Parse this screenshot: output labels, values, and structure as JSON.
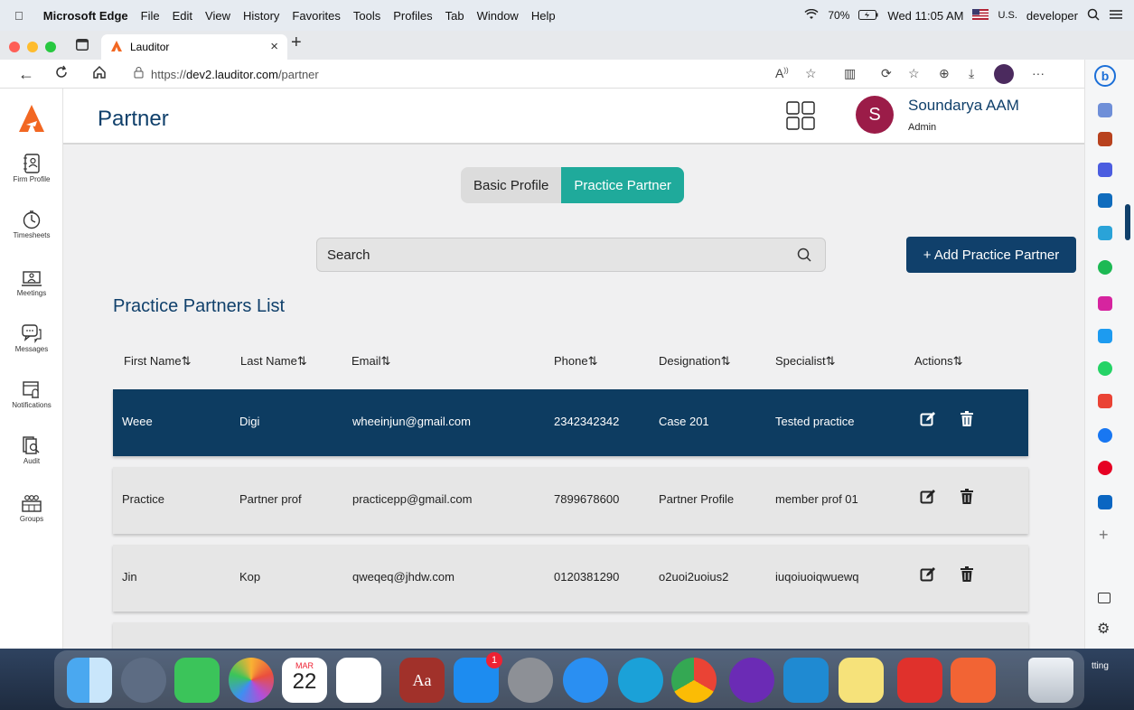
{
  "menubar": {
    "app_name": "Microsoft Edge",
    "menus": [
      "File",
      "Edit",
      "View",
      "History",
      "Favorites",
      "Tools",
      "Profiles",
      "Tab",
      "Window",
      "Help"
    ],
    "battery": "70%",
    "clock": "Wed 11:05 AM",
    "input_source": "U.S.",
    "user": "developer"
  },
  "browser": {
    "tab_title": "Lauditor",
    "url_prefix": "https://",
    "url_host": "dev2.lauditor.com",
    "url_path": "/partner"
  },
  "sidebar": {
    "items": [
      {
        "label": "Firm Profile",
        "icon": "contact-book-icon"
      },
      {
        "label": "Timesheets",
        "icon": "stopwatch-icon"
      },
      {
        "label": "Meetings",
        "icon": "meeting-icon"
      },
      {
        "label": "Messages",
        "icon": "chat-icon"
      },
      {
        "label": "Notifications",
        "icon": "calendar-bell-icon"
      },
      {
        "label": "Audit",
        "icon": "audit-icon"
      },
      {
        "label": "Groups",
        "icon": "groups-icon"
      }
    ]
  },
  "header": {
    "title": "Partner",
    "avatar_letter": "S",
    "user_name": "Soundarya AAM",
    "user_role": "Admin"
  },
  "toggle": {
    "basic": "Basic Profile",
    "practice": "Practice Partner"
  },
  "search": {
    "placeholder": "Search"
  },
  "add_button": "+ Add Practice Partner",
  "list_title": "Practice Partners List",
  "table": {
    "headers": [
      "First Name",
      "Last Name",
      "Email",
      "Phone",
      "Designation",
      "Specialist",
      "Actions"
    ],
    "rows": [
      {
        "first": "Weee",
        "last": "Digi",
        "email": "wheeinjun@gmail.com",
        "phone": "2342342342",
        "designation": "Case 201",
        "specialist": "Tested practice"
      },
      {
        "first": "Practice",
        "last": "Partner prof",
        "email": "practicepp@gmail.com",
        "phone": "7899678600",
        "designation": "Partner Profile",
        "specialist": "member prof 01"
      },
      {
        "first": "Jin",
        "last": "Kop",
        "email": "qweqeq@jhdw.com",
        "phone": "0120381290",
        "designation": "o2uoi2uoius2",
        "specialist": "iuqoiuoiqwuewq"
      }
    ]
  },
  "dock": {
    "calendar_month": "MAR",
    "calendar_day": "22",
    "appstore_badge": "1",
    "partial_label": "tting"
  },
  "colors": {
    "navy": "#10406b",
    "teal": "#1faa9b",
    "avatar": "#9b1c48"
  }
}
